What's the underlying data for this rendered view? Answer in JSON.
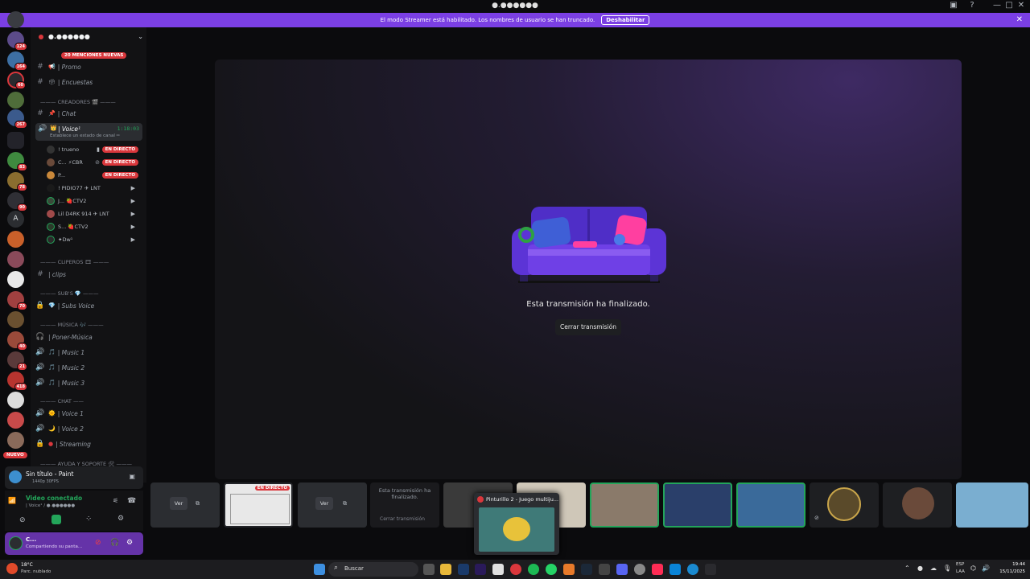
{
  "window": {
    "title": "●.●●●●●●",
    "min": "—",
    "max": "□",
    "close": "✕"
  },
  "banner": {
    "text": "El modo Streamer está habilitado. Los nombres de usuario se han truncado.",
    "button": "Deshabilitar",
    "close": "✕"
  },
  "rail": {
    "badges": [
      "124",
      "164",
      "60",
      "267",
      "83",
      "78",
      "90",
      "70",
      "40",
      "21",
      "418"
    ],
    "letter_a": "A",
    "new_pill": "NUEVO"
  },
  "sidebar": {
    "server_name": "●.●●●●●●",
    "mentions_pill": "20 MENCIONES NUEVAS",
    "channels_top": [
      {
        "icon": "#",
        "label": "| Promo"
      },
      {
        "icon": "#",
        "label": "| Encuestas"
      }
    ],
    "cat_creadores": "——— CREADORES 🎬 ———",
    "chat_creadores": "| Chat",
    "voice": {
      "label": "| Voice¹",
      "time": "1:18:03",
      "status": "Establece un estado de canal ✏"
    },
    "voice_users": [
      {
        "name": "! trueno",
        "live": "EN DIRECTO"
      },
      {
        "name": "C... ⚡CBR",
        "live": "EN DIRECTO"
      },
      {
        "name": "P...",
        "live": "EN DIRECTO"
      },
      {
        "name": "! PIDIO77 ✈ LNT",
        "live": ""
      },
      {
        "name": "J... 🍓CTV2",
        "live": ""
      },
      {
        "name": "Lil D4RK 914 ✈ LNT",
        "live": ""
      },
      {
        "name": "S... 🍓CTV2",
        "live": ""
      },
      {
        "name": "✦Dw¹",
        "live": ""
      }
    ],
    "cat_clip": "——— CLIPEROS 🎞 ———",
    "clips": "| clips",
    "cat_subs": "——— SUB'S 💎 ———",
    "subs_voice": "| Subs Voice",
    "cat_musica": "——— MÚSICA 🎶 ———",
    "music_channels": [
      "| Poner-Música",
      "| Music 1",
      "| Music 2",
      "| Music 3"
    ],
    "cat_chat": "——— CHAT ——",
    "chat_voices": [
      "| Voice 1",
      "| Voice 2",
      "| Streaming"
    ],
    "cat_ayuda": "——— AYUDA Y SOPORTE 🛠 ———"
  },
  "activity": {
    "title": "Sin título - Paint",
    "sub": "1440p 30FPS"
  },
  "voice_panel": {
    "status": "Video conectado",
    "channel": "| Voice¹ / ●.●●●●●●"
  },
  "user_panel": {
    "name": "C...",
    "sub": "Compartiendo su panta..."
  },
  "stage": {
    "ended_text": "Esta transmisión ha finalizado.",
    "close_button": "Cerrar transmisión"
  },
  "tiles": {
    "ver": "Ver",
    "live": "EN DIRECTO",
    "ended": "Esta transmisión ha finalizado.",
    "close": "Cerrar transmisión"
  },
  "popup": {
    "title": "Pinturillo 2 - Juego multiju..."
  },
  "taskbar": {
    "weather_temp": "18°C",
    "weather_desc": "Parc. nublado",
    "search": "Buscar",
    "lang": "ESP",
    "lang2": "LAA",
    "time": "19:44",
    "date": "15/11/2025"
  },
  "colors": {
    "accent": "#7b3fe4",
    "live": "#da373c",
    "voice_green": "#23a55a"
  }
}
